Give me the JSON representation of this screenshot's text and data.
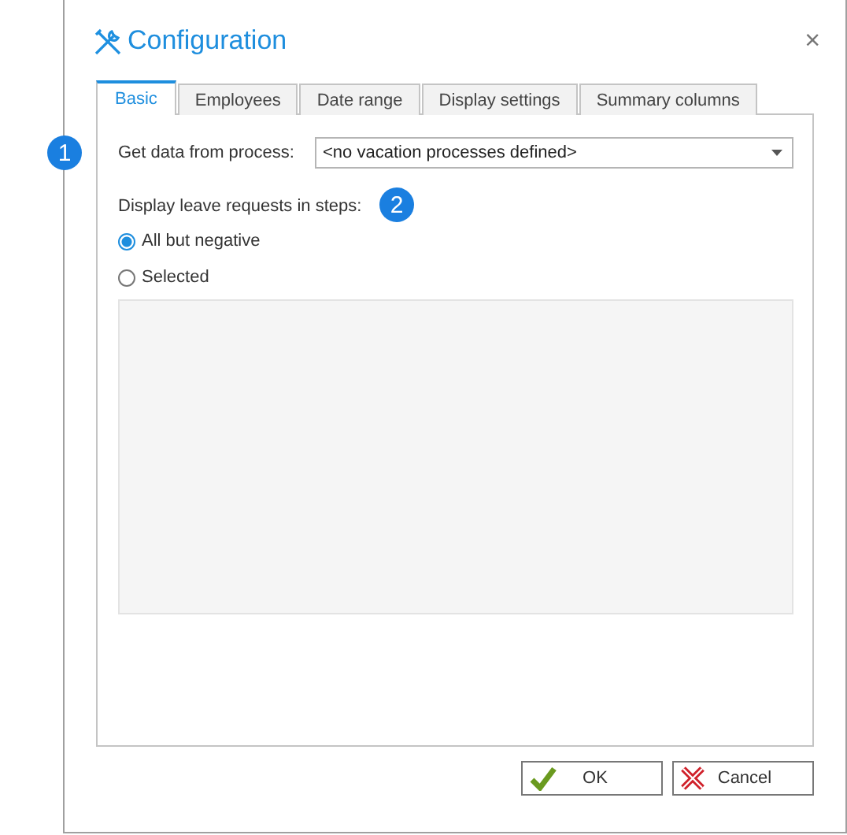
{
  "window": {
    "title": "Configuration",
    "close": "×"
  },
  "tabs": [
    {
      "label": "Basic",
      "selected": true
    },
    {
      "label": "Employees",
      "selected": false
    },
    {
      "label": "Date range",
      "selected": false
    },
    {
      "label": "Display settings",
      "selected": false
    },
    {
      "label": "Summary columns",
      "selected": false
    }
  ],
  "process": {
    "label": "Get data from process:",
    "value": "<no vacation processes defined>"
  },
  "steps": {
    "label": "Display leave requests in steps:",
    "options": [
      {
        "label": "All but negative",
        "selected": true
      },
      {
        "label": "Selected",
        "selected": false
      }
    ]
  },
  "callouts": [
    "1",
    "2"
  ],
  "buttons": [
    {
      "label": "OK",
      "kind": "ok"
    },
    {
      "label": "Cancel",
      "kind": "cancel"
    }
  ]
}
